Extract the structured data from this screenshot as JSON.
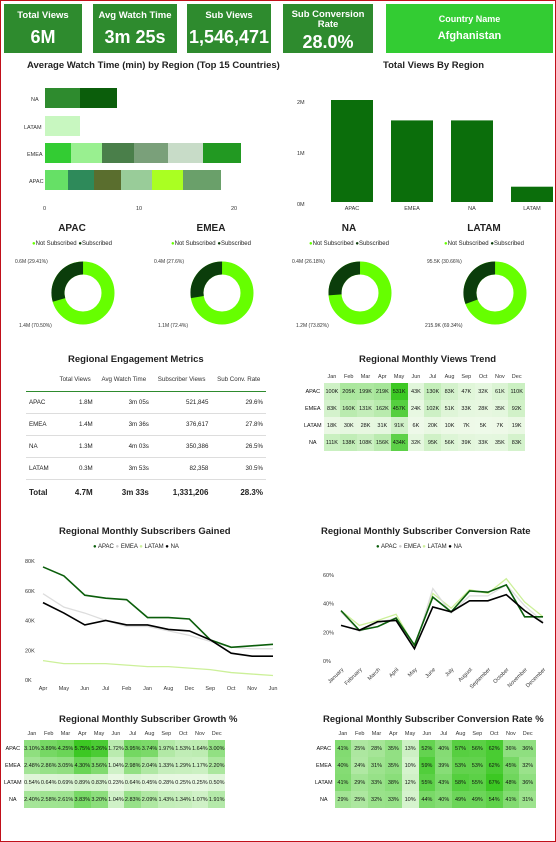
{
  "kpis": [
    {
      "title": "Total Views",
      "value": "6M"
    },
    {
      "title": "Avg Watch Time",
      "value": "3m 25s"
    },
    {
      "title": "Sub Views",
      "value": "1,546,471"
    },
    {
      "title": "Sub Conversion Rate",
      "value": "28.0%"
    }
  ],
  "country_filter": {
    "title": "Country Name",
    "value": "Afghanistan"
  },
  "charts": {
    "watch_time": {
      "title": "Average Watch Time (min) by Region (Top 15 Countries)",
      "regions": [
        "NA",
        "LATAM",
        "EMEA",
        "APAC"
      ],
      "ticks": [
        "0",
        "10",
        "20"
      ]
    },
    "total_views": {
      "title": "Total Views By Region",
      "ticks": [
        "2M",
        "1M",
        "0M"
      ]
    },
    "engagement": {
      "title": "Regional Engagement Metrics"
    },
    "monthly_views": {
      "title": "Regional Monthly Views Trend"
    },
    "subs_gained": {
      "title": "Regional Monthly Subscribers Gained"
    },
    "conv_rate": {
      "title": "Regional Monthly Subscriber Conversion Rate"
    },
    "growth": {
      "title": "Regional Monthly Subscriber Growth %"
    },
    "conv_pct": {
      "title": "Regional Monthly Subscriber Conversion Rate %"
    }
  },
  "legend_donut": {
    "not_sub": "Not Subscribed",
    "sub": "Subscribed"
  },
  "line_legend": {
    "apac": "APAC",
    "emea": "EMEA",
    "latam": "LATAM",
    "na": "NA"
  },
  "donuts": [
    {
      "region": "APAC",
      "not_sub_label": "1.4M (70.50%)",
      "sub_label": "0.6M (29.41%)",
      "sub_frac": 0.295
    },
    {
      "region": "EMEA",
      "not_sub_label": "1.1M (72.4%)",
      "sub_label": "0.4M (27.6%)",
      "sub_frac": 0.276
    },
    {
      "region": "NA",
      "not_sub_label": "1.2M (73.82%)",
      "sub_label": "0.4M (26.18%)",
      "sub_frac": 0.262
    },
    {
      "region": "LATAM",
      "not_sub_label": "215.9K (69.34%)",
      "sub_label": "95.5K (30.66%)",
      "sub_frac": 0.307
    }
  ],
  "engagement_table": {
    "headers": [
      "Total Views",
      "Avg Watch Time",
      "Subscriber Views",
      "Sub Conv. Rate"
    ],
    "rows": [
      {
        "region": "APAC",
        "views": "1.8M",
        "watch": "3m 05s",
        "subs": "521,845",
        "rate": "29.6%"
      },
      {
        "region": "EMEA",
        "views": "1.4M",
        "watch": "3m 36s",
        "subs": "376,617",
        "rate": "27.8%"
      },
      {
        "region": "NA",
        "views": "1.3M",
        "watch": "4m 03s",
        "subs": "350,386",
        "rate": "26.5%"
      },
      {
        "region": "LATAM",
        "views": "0.3M",
        "watch": "3m 53s",
        "subs": "82,358",
        "rate": "30.5%"
      }
    ],
    "total": {
      "label": "Total",
      "views": "4.7M",
      "watch": "3m 33s",
      "subs": "1,331,206",
      "rate": "28.3%"
    }
  },
  "months_short": [
    "Jan",
    "Feb",
    "Mar",
    "Apr",
    "May",
    "Jun",
    "Jul",
    "Aug",
    "Sep",
    "Oct",
    "Nov",
    "Dec"
  ],
  "views_heatmap": {
    "APAC": [
      "100K",
      "205K",
      "199K",
      "219K",
      "531K",
      "43K",
      "130K",
      "83K",
      "47K",
      "32K",
      "61K",
      "110K"
    ],
    "EMEA": [
      "83K",
      "160K",
      "131K",
      "162K",
      "457K",
      "24K",
      "102K",
      "51K",
      "33K",
      "28K",
      "35K",
      "92K"
    ],
    "LATAM": [
      "18K",
      "30K",
      "28K",
      "31K",
      "91K",
      "6K",
      "20K",
      "10K",
      "7K",
      "5K",
      "7K",
      "19K"
    ],
    "NA": [
      "111K",
      "138K",
      "108K",
      "156K",
      "434K",
      "32K",
      "95K",
      "56K",
      "39K",
      "33K",
      "35K",
      "83K"
    ]
  },
  "subs_line": {
    "x_labels": [
      "Apr",
      "May",
      "Jun",
      "Jul",
      "Feb",
      "Jan",
      "Aug",
      "Dec",
      "Sep",
      "Oct",
      "Nov",
      "Jun"
    ],
    "y_ticks": [
      "80K",
      "60K",
      "40K",
      "20K",
      "0K"
    ],
    "APAC": [
      76,
      70,
      57,
      55,
      54,
      42,
      42,
      41,
      27,
      22,
      23,
      24
    ],
    "EMEA": [
      58,
      49,
      45,
      40,
      36,
      36,
      33,
      30,
      26,
      22,
      21,
      21
    ],
    "NA": [
      52,
      45,
      37,
      40,
      37,
      37,
      34,
      33,
      27,
      18,
      16,
      16
    ],
    "LATAM": [
      13,
      11,
      11,
      11,
      10,
      9,
      9,
      8,
      7,
      5,
      4,
      3
    ]
  },
  "conv_line": {
    "x_labels": [
      "January",
      "February",
      "March",
      "April",
      "May",
      "June",
      "July",
      "August",
      "September",
      "October",
      "November",
      "December"
    ],
    "y_ticks": [
      "60%",
      "40%",
      "20%",
      "0%"
    ],
    "APAC": [
      41,
      25,
      28,
      35,
      13,
      52,
      40,
      57,
      56,
      62,
      36,
      36
    ],
    "EMEA": [
      40,
      24,
      31,
      35,
      10,
      59,
      39,
      53,
      53,
      62,
      45,
      32
    ],
    "LATAM": [
      41,
      29,
      33,
      38,
      12,
      55,
      43,
      58,
      55,
      67,
      48,
      36
    ],
    "NA": [
      29,
      25,
      32,
      33,
      10,
      44,
      40,
      49,
      49,
      54,
      41,
      31
    ]
  },
  "growth_heatmap": {
    "APAC": [
      "3.10%",
      "3.89%",
      "4.25%",
      "5.75%",
      "5.26%",
      "1.72%",
      "3.95%",
      "3.74%",
      "1.97%",
      "1.53%",
      "1.64%",
      "3.00%"
    ],
    "EMEA": [
      "2.48%",
      "2.86%",
      "3.05%",
      "4.30%",
      "3.56%",
      "1.04%",
      "2.98%",
      "2.04%",
      "1.33%",
      "1.29%",
      "1.17%",
      "2.20%"
    ],
    "LATAM": [
      "0.54%",
      "0.64%",
      "0.69%",
      "0.89%",
      "0.83%",
      "0.23%",
      "0.64%",
      "0.45%",
      "0.28%",
      "0.25%",
      "0.25%",
      "0.50%"
    ],
    "NA": [
      "2.40%",
      "2.58%",
      "2.61%",
      "3.83%",
      "3.20%",
      "1.04%",
      "2.83%",
      "2.09%",
      "1.43%",
      "1.34%",
      "1.07%",
      "1.91%"
    ]
  },
  "conv_heatmap": {
    "APAC": [
      "41%",
      "25%",
      "28%",
      "35%",
      "13%",
      "52%",
      "40%",
      "57%",
      "56%",
      "62%",
      "36%",
      "36%"
    ],
    "EMEA": [
      "40%",
      "24%",
      "31%",
      "35%",
      "10%",
      "59%",
      "39%",
      "53%",
      "53%",
      "62%",
      "45%",
      "32%"
    ],
    "LATAM": [
      "41%",
      "29%",
      "33%",
      "38%",
      "12%",
      "55%",
      "43%",
      "58%",
      "55%",
      "67%",
      "48%",
      "36%"
    ],
    "NA": [
      "29%",
      "25%",
      "32%",
      "33%",
      "10%",
      "44%",
      "40%",
      "49%",
      "49%",
      "54%",
      "41%",
      "31%"
    ]
  },
  "chart_data": [
    {
      "type": "bar",
      "title": "Total Views By Region",
      "categories": [
        "APAC",
        "EMEA",
        "NA",
        "LATAM"
      ],
      "values": [
        2.0,
        1.6,
        1.6,
        0.3
      ],
      "ylim": [
        0,
        2.3
      ],
      "ylabel_unit": "M"
    },
    {
      "type": "line",
      "title": "Regional Monthly Subscribers Gained",
      "ylim": [
        0,
        80
      ],
      "series": [
        {
          "name": "APAC"
        },
        {
          "name": "EMEA"
        },
        {
          "name": "LATAM"
        },
        {
          "name": "NA"
        }
      ]
    },
    {
      "type": "line",
      "title": "Regional Monthly Subscriber Conversion Rate",
      "ylim": [
        0,
        70
      ],
      "series": [
        {
          "name": "APAC"
        },
        {
          "name": "EMEA"
        },
        {
          "name": "LATAM"
        },
        {
          "name": "NA"
        }
      ]
    }
  ],
  "colors": {
    "accent": "#2e8b2e",
    "bright": "#33cc33",
    "dark": "#0b5e0b",
    "lime": "#66ff00"
  }
}
